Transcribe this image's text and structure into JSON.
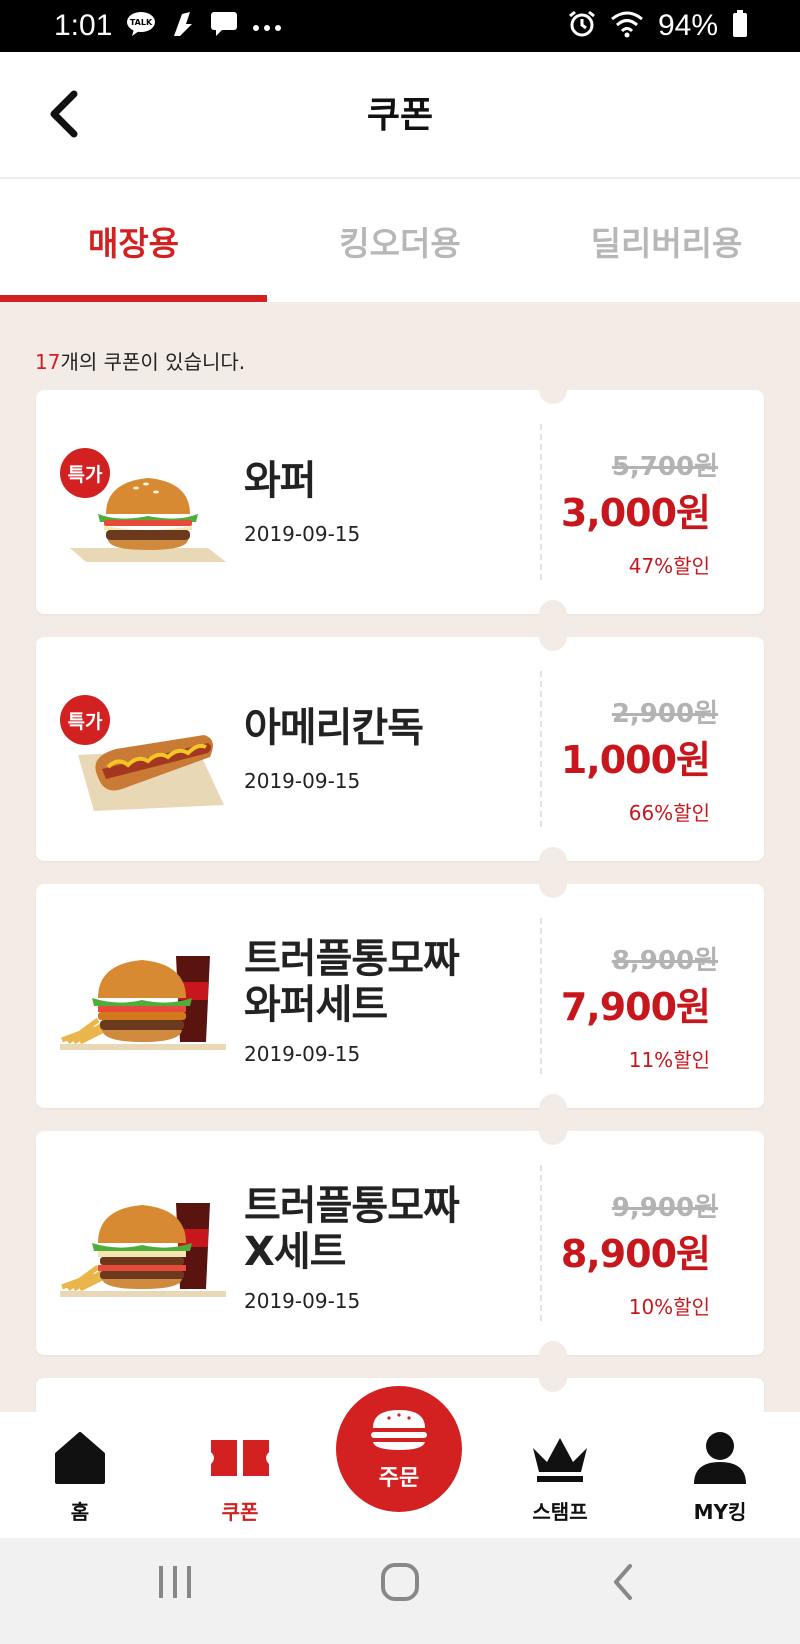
{
  "status_bar": {
    "time": "1:01",
    "battery_pct": "94%"
  },
  "header": {
    "title": "쿠폰"
  },
  "tabs": [
    {
      "label": "매장용",
      "active": true
    },
    {
      "label": "킹오더용",
      "active": false
    },
    {
      "label": "딜리버리용",
      "active": false
    }
  ],
  "coupon_count": {
    "number": "17",
    "text": "개의 쿠폰이 있습니다."
  },
  "coupons": [
    {
      "name_line1": "와퍼",
      "name_line2": "",
      "date": "2019-09-15",
      "original_price": "5,700원",
      "price": "3,000원",
      "discount": "47%할인",
      "badge": "특가",
      "image": "whopper-burger"
    },
    {
      "name_line1": "아메리칸독",
      "name_line2": "",
      "date": "2019-09-15",
      "original_price": "2,900원",
      "price": "1,000원",
      "discount": "66%할인",
      "badge": "특가",
      "image": "hotdog"
    },
    {
      "name_line1": "트러플통모짜",
      "name_line2": "와퍼세트",
      "date": "2019-09-15",
      "original_price": "8,900원",
      "price": "7,900원",
      "discount": "11%할인",
      "badge": "",
      "image": "burger-set"
    },
    {
      "name_line1": "트러플통모짜",
      "name_line2": "X세트",
      "date": "2019-09-15",
      "original_price": "9,900원",
      "price": "8,900원",
      "discount": "10%할인",
      "badge": "",
      "image": "burger-set"
    }
  ],
  "bottom_nav": {
    "home": "홈",
    "coupon": "쿠폰",
    "order": "주문",
    "stamp": "스탬프",
    "my": "MY킹"
  },
  "colors": {
    "accent": "#d32020",
    "price": "#c8171c",
    "background": "#f3ece6",
    "inactive_tab": "#b7b7b7"
  }
}
